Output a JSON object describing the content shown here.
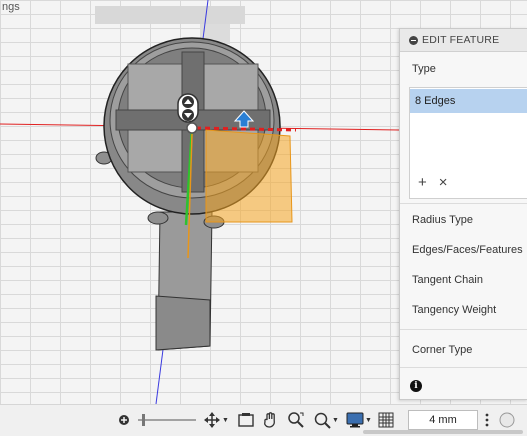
{
  "app": {
    "prev_label": "ngs"
  },
  "panel": {
    "title": "EDIT FEATURE",
    "type_label": "Type",
    "selection_item": "8 Edges",
    "add_label": "+",
    "remove_label": "×",
    "radius_type_label": "Radius Type",
    "edges_label": "Edges/Faces/Features",
    "tangent_chain_label": "Tangent Chain",
    "tangency_weight_label": "Tangency Weight",
    "corner_type_label": "Corner Type",
    "info_label": "i"
  },
  "toolbar": {
    "distance_value": "4 mm",
    "icons": [
      "add-icon",
      "orbit-icon",
      "pan-icon",
      "hand-icon",
      "zoom-fit-icon",
      "zoom-window-icon",
      "display-icon",
      "grid-icon",
      "more-icon"
    ]
  },
  "colors": {
    "selection": "#b7d2ef",
    "axis_red": "#e02020",
    "axis_green": "#2fc12f",
    "axis_blue": "#3a3ae0",
    "highlight": "#f5a623"
  }
}
